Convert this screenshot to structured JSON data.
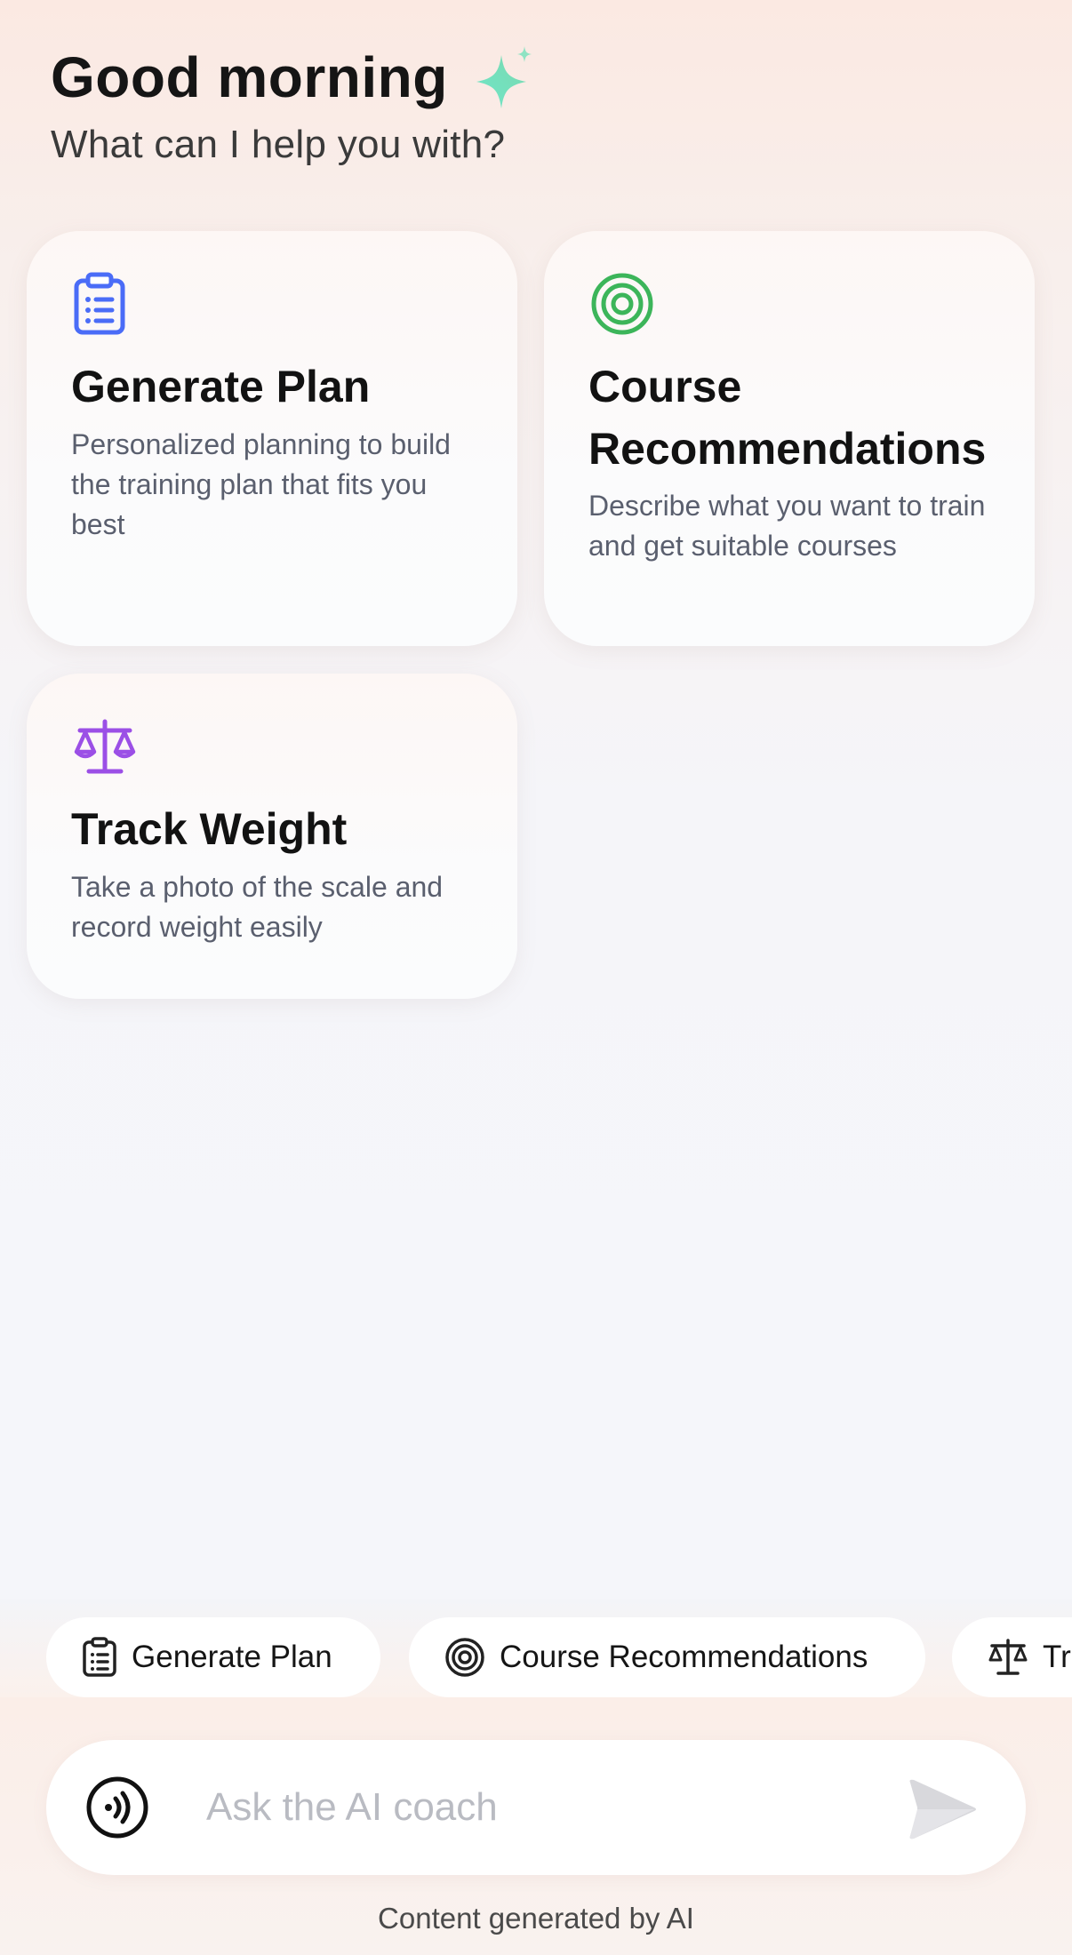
{
  "header": {
    "greeting": "Good morning",
    "subtitle": "What can I help you with?",
    "sparkle_icon": "sparkle-icon"
  },
  "cards": [
    {
      "title": "Generate Plan",
      "description": "Personalized planning to build the training plan that fits you best",
      "icon": "clipboard-icon",
      "icon_color": "#4a6cf7"
    },
    {
      "title": "Course Recommendations",
      "description": "Describe what you want to train and get suitable courses",
      "icon": "target-icon",
      "icon_color": "#3cb55a"
    },
    {
      "title": "Track Weight",
      "description": "Take a photo of the scale and record weight easily",
      "icon": "scale-icon",
      "icon_color": "#9b4fe6"
    }
  ],
  "chips": [
    {
      "label": "Generate Plan",
      "icon": "clipboard-icon"
    },
    {
      "label": "Course Recommendations",
      "icon": "target-icon"
    },
    {
      "label": "Track Weight",
      "icon": "scale-icon"
    }
  ],
  "composer": {
    "placeholder": "Ask the AI coach",
    "voice_icon": "voice-icon",
    "send_icon": "send-icon"
  },
  "footer": {
    "note": "Content generated by AI"
  }
}
